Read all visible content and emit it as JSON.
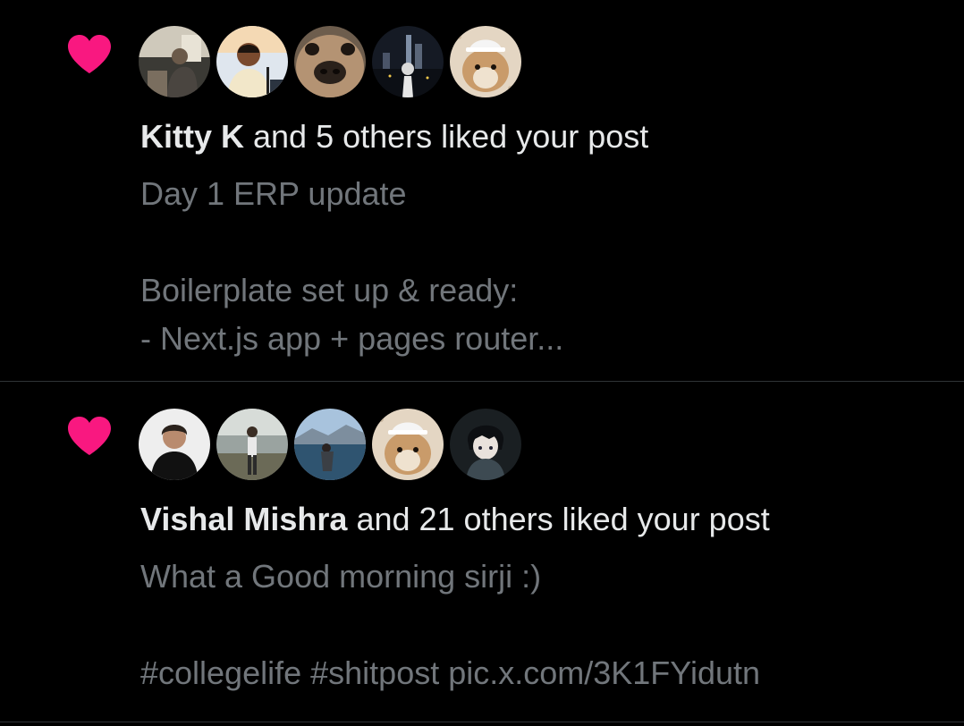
{
  "colors": {
    "background": "#000000",
    "heart": "#f91880",
    "primary_text": "#e7e9ea",
    "secondary_text": "#71767b",
    "divider": "#2f3336"
  },
  "notifications": [
    {
      "icon": "heart-icon",
      "avatars": [
        "avatar-person-reading",
        "avatar-speaker-mic",
        "avatar-dog-closeup",
        "avatar-city-night",
        "avatar-hamster-hat"
      ],
      "actor": "Kitty K",
      "action": " and 5 others liked your post",
      "preview": {
        "line1": "Day 1 ERP update",
        "line2": "",
        "line3": "Boilerplate set up & ready:",
        "line4": "- Next.js app + pages router..."
      }
    },
    {
      "icon": "heart-icon",
      "avatars": [
        "avatar-man-black-turtleneck",
        "avatar-person-walking",
        "avatar-lake-landscape",
        "avatar-hamster-hat",
        "avatar-anime-character"
      ],
      "actor": "Vishal Mishra",
      "action": " and 21 others liked your post",
      "preview": {
        "line1": "What a Good morning sirji :)",
        "line2": "",
        "line3": "#collegelife #shitpost pic.x.com/3K1FYidutn"
      }
    }
  ]
}
